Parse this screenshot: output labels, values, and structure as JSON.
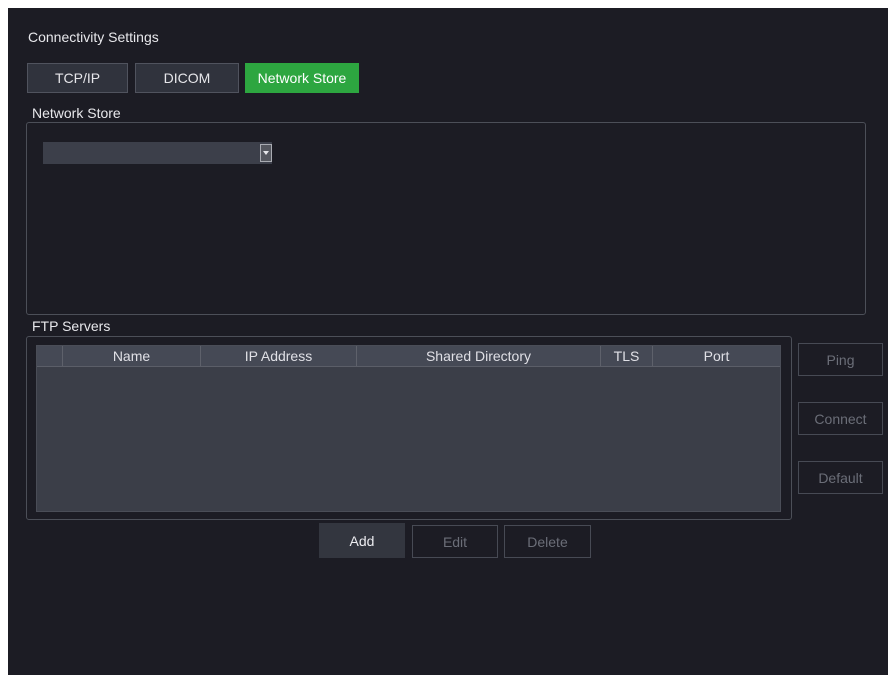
{
  "window": {
    "title": "Connectivity Settings"
  },
  "tabs": [
    {
      "label": "TCP/IP",
      "active": false
    },
    {
      "label": "DICOM",
      "active": false
    },
    {
      "label": "Network Store",
      "active": true
    }
  ],
  "network_store": {
    "group_label": "Network Store",
    "dropdown_value": ""
  },
  "ftp_servers": {
    "group_label": "FTP Servers",
    "columns": [
      "Name",
      "IP Address",
      "Shared Directory",
      "TLS",
      "Port"
    ],
    "rows": []
  },
  "side_buttons": {
    "ping": "Ping",
    "connect": "Connect",
    "default": "Default"
  },
  "bottom_buttons": {
    "add": "Add",
    "edit": "Edit",
    "delete": "Delete"
  },
  "colors": {
    "background": "#1c1c24",
    "active_tab": "#2da640",
    "table_bg": "#3b3e48",
    "disabled_text": "#6b6e78"
  },
  "icons": {
    "dropdown": "chevron-down-icon"
  }
}
